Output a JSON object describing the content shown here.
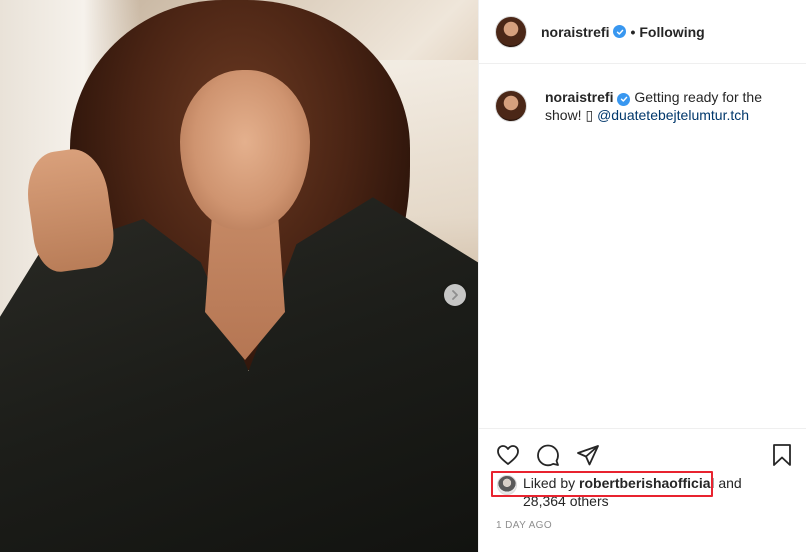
{
  "post": {
    "author": {
      "username": "noraistrefi",
      "verified": true
    },
    "follow_separator": "•",
    "follow_status": "Following",
    "caption": {
      "username": "noraistrefi",
      "text": "Getting ready for the show! ▯",
      "mention": "@duatetebejtelumtur.tch"
    },
    "likes": {
      "prefix": "Liked by",
      "liked_by": "robertberishaofficial",
      "joiner": "and",
      "others": "28,364 others"
    },
    "timestamp": "1 DAY AGO"
  },
  "icons": {
    "like": "heart-icon",
    "comment": "comment-icon",
    "share": "share-icon",
    "save": "bookmark-icon",
    "next": "chevron-right-icon",
    "verified": "verified-badge-icon"
  },
  "colors": {
    "text": "#262626",
    "verified_blue": "#3897f0",
    "mention": "#00376b",
    "muted": "#8e8e8e",
    "highlight": "#e8232f",
    "divider": "#efefef"
  }
}
